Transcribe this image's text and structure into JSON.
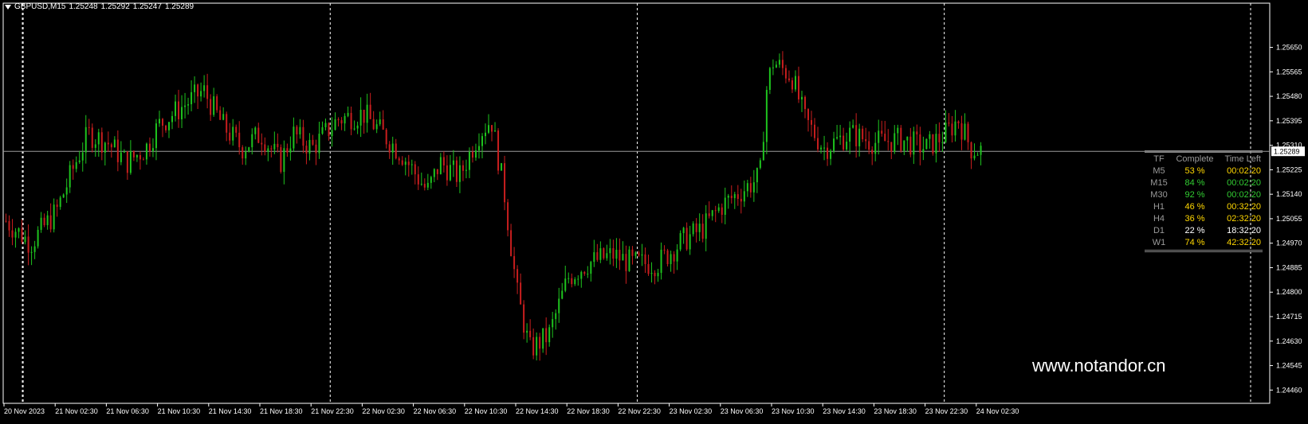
{
  "header": {
    "symbol": "GBPUSD,M15",
    "open": "1.25248",
    "high": "1.25292",
    "low": "1.25247",
    "close": "1.25289"
  },
  "colors": {
    "bull": "#1ec31e",
    "bear": "#c81e1e",
    "grid": "#ffffff",
    "axis": "#ffffff",
    "bid_line": "#9c9c9c",
    "yellow": "#ffd700",
    "lime": "#32cd32",
    "gray": "#9a9a9a",
    "white": "#ffffff"
  },
  "watermark": "www.notandor.cn",
  "tf_table": {
    "headers": [
      "TF",
      "Complete",
      "Time Left"
    ],
    "rows": [
      {
        "tf": "M5",
        "complete": "53 %",
        "left": "00:02:20",
        "color": "yellow"
      },
      {
        "tf": "M15",
        "complete": "84 %",
        "left": "00:02:20",
        "color": "lime"
      },
      {
        "tf": "M30",
        "complete": "92 %",
        "left": "00:02:20",
        "color": "lime"
      },
      {
        "tf": "H1",
        "complete": "46 %",
        "left": "00:32:20",
        "color": "yellow"
      },
      {
        "tf": "H4",
        "complete": "36 %",
        "left": "02:32:20",
        "color": "yellow"
      },
      {
        "tf": "D1",
        "complete": "22 %",
        "left": "18:32:20",
        "color": "white"
      },
      {
        "tf": "W1",
        "complete": "74 %",
        "left": "42:32:20",
        "color": "yellow"
      }
    ]
  },
  "chart_data": {
    "type": "candlestick",
    "title": "GBPUSD,M15",
    "ylim": [
      1.24425,
      1.25715
    ],
    "y_ticks": [
      "1.25650",
      "1.25565",
      "1.25480",
      "1.25395",
      "1.25310",
      "1.25225",
      "1.25140",
      "1.25055",
      "1.24970",
      "1.24885",
      "1.24800",
      "1.24715",
      "1.24630",
      "1.24545",
      "1.24460"
    ],
    "current_price": "1.25289",
    "x_ticks": [
      "20 Nov 2023",
      "21 Nov 02:30",
      "21 Nov 06:30",
      "21 Nov 10:30",
      "21 Nov 14:30",
      "21 Nov 18:30",
      "21 Nov 22:30",
      "22 Nov 02:30",
      "22 Nov 06:30",
      "22 Nov 10:30",
      "22 Nov 14:30",
      "22 Nov 18:30",
      "22 Nov 22:30",
      "23 Nov 02:30",
      "23 Nov 06:30",
      "23 Nov 10:30",
      "23 Nov 14:30",
      "23 Nov 18:30",
      "23 Nov 22:30",
      "24 Nov 02:30"
    ],
    "day_separators": [
      "21 Nov",
      "22 Nov",
      "23 Nov",
      "24 Nov"
    ],
    "close_path": [
      [
        "20 Nov 2023",
        1.251
      ],
      [
        "20 Nov 22:30",
        1.2505
      ],
      [
        "21 Nov 00:30",
        1.2497
      ],
      [
        "21 Nov 02:30",
        1.2508
      ],
      [
        "21 Nov 04:00",
        1.2525
      ],
      [
        "21 Nov 05:00",
        1.2535
      ],
      [
        "21 Nov 06:30",
        1.2532
      ],
      [
        "21 Nov 08:00",
        1.2525
      ],
      [
        "21 Nov 09:30",
        1.253
      ],
      [
        "21 Nov 10:30",
        1.2538
      ],
      [
        "21 Nov 12:30",
        1.2545
      ],
      [
        "21 Nov 14:00",
        1.255
      ],
      [
        "21 Nov 15:30",
        1.2538
      ],
      [
        "21 Nov 17:00",
        1.253
      ],
      [
        "21 Nov 18:30",
        1.2535
      ],
      [
        "21 Nov 20:00",
        1.2525
      ],
      [
        "21 Nov 21:00",
        1.2535
      ],
      [
        "21 Nov 22:30",
        1.253
      ],
      [
        "22 Nov 00:30",
        1.254
      ],
      [
        "22 Nov 02:30",
        1.2542
      ],
      [
        "22 Nov 04:00",
        1.2535
      ],
      [
        "22 Nov 05:30",
        1.2528
      ],
      [
        "22 Nov 07:30",
        1.2515
      ],
      [
        "22 Nov 08:30",
        1.2525
      ],
      [
        "22 Nov 10:00",
        1.252
      ],
      [
        "22 Nov 11:30",
        1.2535
      ],
      [
        "22 Nov 12:30",
        1.254
      ],
      [
        "22 Nov 13:30",
        1.2515
      ],
      [
        "22 Nov 14:30",
        1.248
      ],
      [
        "22 Nov 15:30",
        1.246
      ],
      [
        "22 Nov 17:00",
        1.2465
      ],
      [
        "22 Nov 18:30",
        1.2485
      ],
      [
        "22 Nov 20:00",
        1.249
      ],
      [
        "22 Nov 22:00",
        1.2493
      ],
      [
        "22 Nov 23:30",
        1.249
      ],
      [
        "23 Nov 01:30",
        1.249
      ],
      [
        "23 Nov 03:30",
        1.2498
      ],
      [
        "23 Nov 05:00",
        1.2502
      ],
      [
        "23 Nov 06:30",
        1.251
      ],
      [
        "23 Nov 08:00",
        1.2515
      ],
      [
        "23 Nov 09:30",
        1.252
      ],
      [
        "23 Nov 10:00",
        1.255
      ],
      [
        "23 Nov 10:30",
        1.256
      ],
      [
        "23 Nov 12:00",
        1.2555
      ],
      [
        "23 Nov 13:00",
        1.254
      ],
      [
        "23 Nov 14:30",
        1.253
      ],
      [
        "23 Nov 16:30",
        1.2535
      ],
      [
        "23 Nov 18:30",
        1.2532
      ],
      [
        "23 Nov 20:30",
        1.2533
      ],
      [
        "23 Nov 22:30",
        1.253
      ],
      [
        "24 Nov 00:00",
        1.2535
      ],
      [
        "24 Nov 01:00",
        1.254
      ],
      [
        "24 Nov 02:00",
        1.253
      ],
      [
        "24 Nov 03:00",
        1.2529
      ]
    ]
  }
}
